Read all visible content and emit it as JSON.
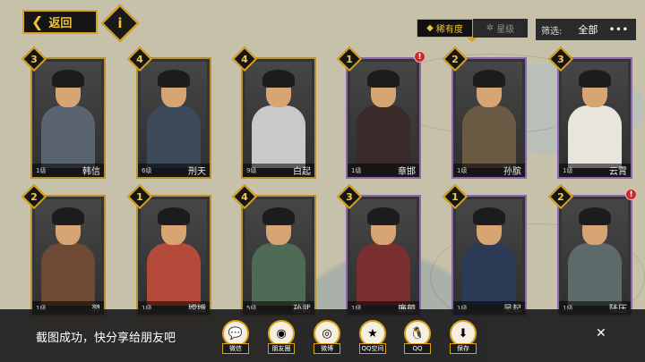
{
  "topbar": {
    "back_label": "返回",
    "info_glyph": "i"
  },
  "sort_tabs": [
    {
      "label": "稀有度",
      "active": true
    },
    {
      "label": "星级",
      "active": false
    }
  ],
  "filter": {
    "label": "筛选:",
    "value": "全部",
    "more": "•••"
  },
  "cards": [
    {
      "rank": "3",
      "level": "1级",
      "name": "韩信",
      "frame": "gold",
      "alert": false
    },
    {
      "rank": "4",
      "level": "6级",
      "name": "刑天",
      "frame": "gold",
      "alert": false
    },
    {
      "rank": "4",
      "level": "9级",
      "name": "白起",
      "frame": "gold",
      "alert": false
    },
    {
      "rank": "1",
      "level": "1级",
      "name": "章邯",
      "frame": "purple",
      "alert": true
    },
    {
      "rank": "2",
      "level": "1级",
      "name": "孙膑",
      "frame": "purple",
      "alert": false
    },
    {
      "rank": "3",
      "level": "1级",
      "name": "云霄",
      "frame": "purple",
      "alert": false
    },
    {
      "rank": "2",
      "level": "1级",
      "name": "羿",
      "frame": "gold",
      "alert": false
    },
    {
      "rank": "1",
      "level": "1级",
      "name": "嫦娥",
      "frame": "gold",
      "alert": false
    },
    {
      "rank": "4",
      "level": "5级",
      "name": "孙武",
      "frame": "gold",
      "alert": false
    },
    {
      "rank": "3",
      "level": "1级",
      "name": "廉颇",
      "frame": "purple",
      "alert": false
    },
    {
      "rank": "1",
      "level": "1级",
      "name": "吴起",
      "frame": "purple",
      "alert": false
    },
    {
      "rank": "2",
      "level": "1级",
      "name": "陆压",
      "frame": "purple",
      "alert": true
    }
  ],
  "share": {
    "message": "截图成功，快分享给朋友吧",
    "targets": [
      {
        "label": "微信",
        "icon": "wechat-icon",
        "glyph": "💬"
      },
      {
        "label": "朋友圈",
        "icon": "moments-icon",
        "glyph": "◉"
      },
      {
        "label": "微博",
        "icon": "weibo-icon",
        "glyph": "◎"
      },
      {
        "label": "QQ空间",
        "icon": "qzone-icon",
        "glyph": "★"
      },
      {
        "label": "QQ",
        "icon": "qq-icon",
        "glyph": "🐧"
      },
      {
        "label": "保存",
        "icon": "save-icon",
        "glyph": "⬇"
      }
    ],
    "close": "✕"
  },
  "colors": {
    "gold_frame": "#b9912e",
    "purple_frame": "#8e64b4",
    "accent": "#f0c33a"
  }
}
